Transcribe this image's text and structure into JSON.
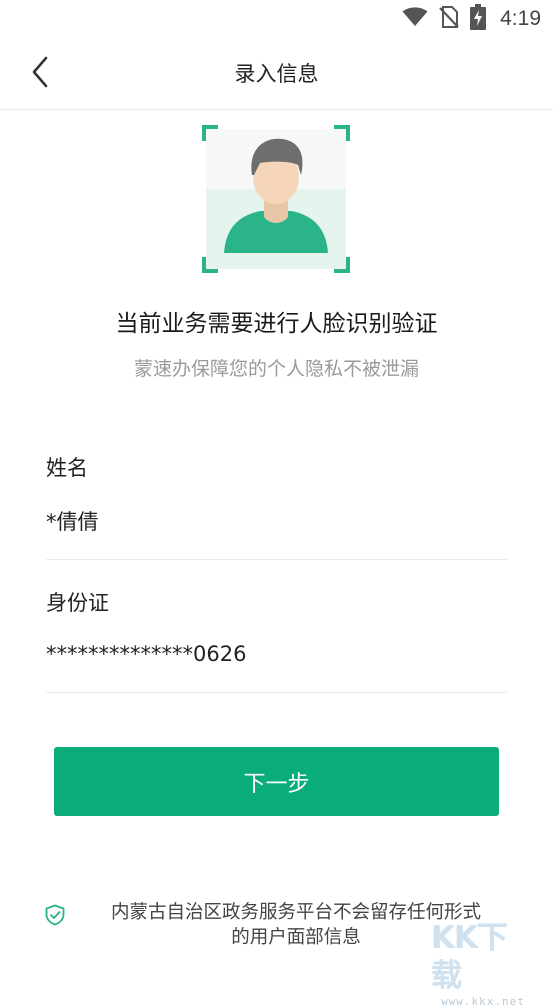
{
  "status_bar": {
    "time": "4:19",
    "icons": [
      "wifi-icon",
      "no-sim-icon",
      "battery-charging-icon"
    ]
  },
  "nav": {
    "title": "录入信息",
    "back_icon": "chevron-left-icon"
  },
  "face_illustration": {
    "icon": "user-face-scan-icon",
    "accent_color": "#2bb38a"
  },
  "headline": "当前业务需要进行人脸识别验证",
  "subline": "蒙速办保障您的个人隐私不被泄漏",
  "form": {
    "name": {
      "label": "姓名",
      "value": "*倩倩"
    },
    "id_card": {
      "label": "身份证",
      "value": "**************0626"
    }
  },
  "next_button": {
    "label": "下一步",
    "color": "#0aad7a"
  },
  "notice": {
    "icon": "shield-check-icon",
    "text_line1": "内蒙古自治区政务服务平台不会留存任何形式",
    "text_line2": "的用户面部信息"
  },
  "watermark": {
    "logo": "KK下载",
    "url": "www.kkx.net"
  }
}
